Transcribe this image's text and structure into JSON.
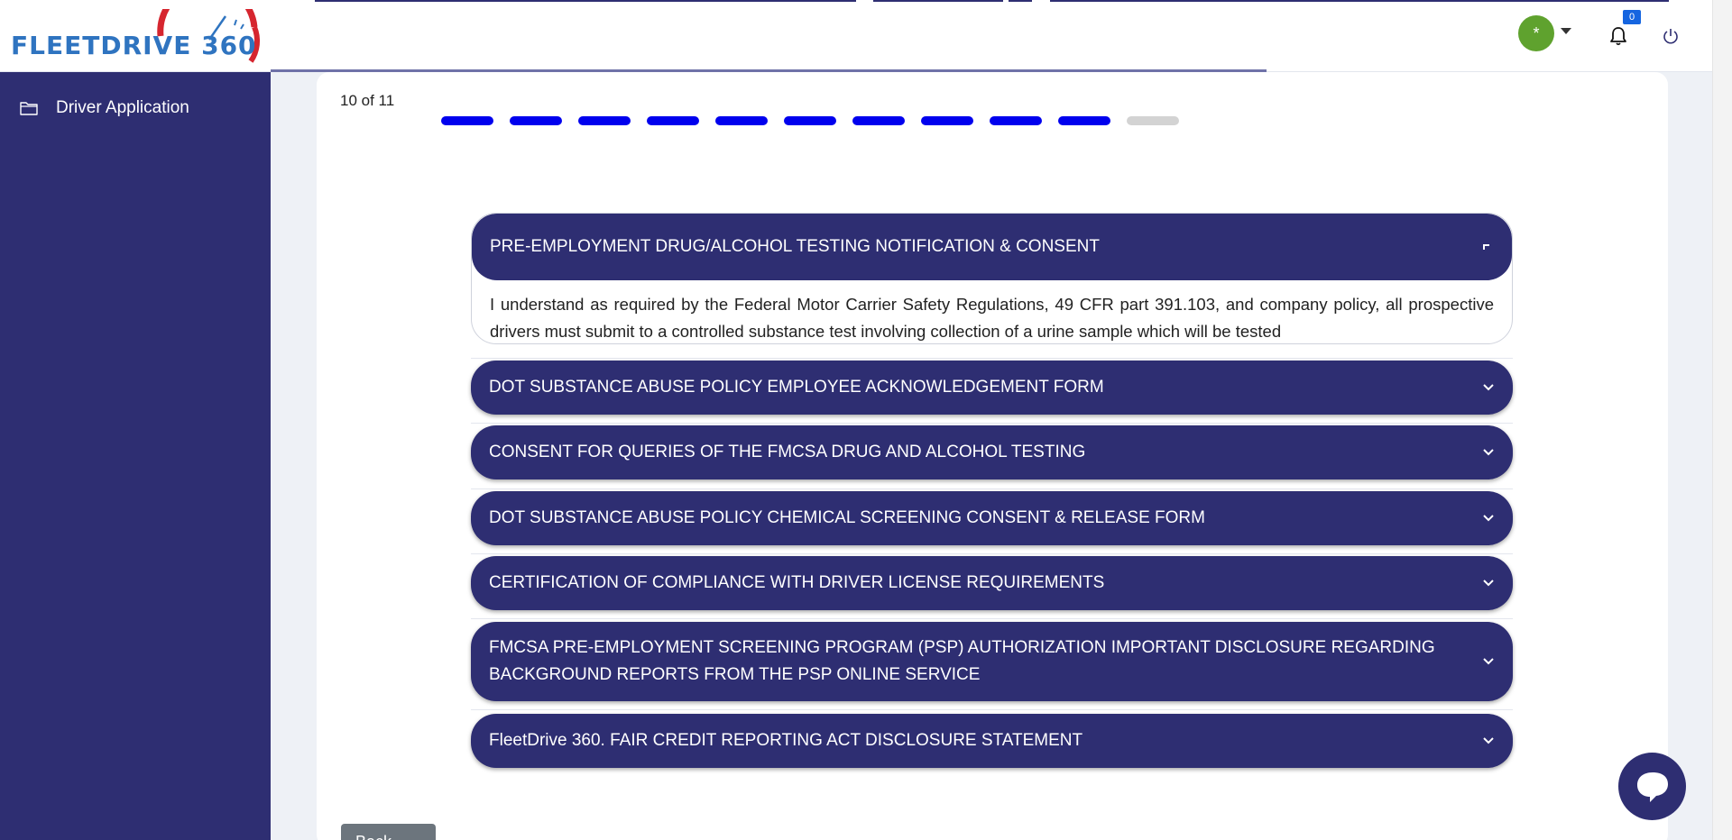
{
  "brand": {
    "logo_text": "FLEETDRIVE 360"
  },
  "header": {
    "avatar_symbol": "*",
    "notification_count": "0"
  },
  "sidebar": {
    "items": [
      {
        "label": "Driver Application",
        "icon": "folder-icon"
      }
    ]
  },
  "wizard": {
    "step_text": "10 of 11",
    "current_step": 10,
    "total_steps": 11
  },
  "sections": [
    {
      "title": "PRE-EMPLOYMENT DRUG/ALCOHOL TESTING NOTIFICATION & CONSENT",
      "expanded": true,
      "body": "I understand as required by the Federal Motor Carrier Safety Regulations, 49 CFR part 391.103, and company policy, all prospective drivers must submit to a controlled substance test involving collection of a urine sample which will be tested"
    },
    {
      "title": "DOT SUBSTANCE ABUSE POLICY EMPLOYEE ACKNOWLEDGEMENT FORM",
      "expanded": false
    },
    {
      "title": "CONSENT FOR QUERIES OF THE FMCSA DRUG AND ALCOHOL TESTING",
      "expanded": false
    },
    {
      "title": "DOT SUBSTANCE ABUSE POLICY CHEMICAL SCREENING CONSENT & RELEASE FORM",
      "expanded": false
    },
    {
      "title": "CERTIFICATION OF COMPLIANCE WITH DRIVER LICENSE REQUIREMENTS",
      "expanded": false
    },
    {
      "title": "FMCSA PRE-EMPLOYMENT SCREENING PROGRAM (PSP) AUTHORIZATION IMPORTANT DISCLOSURE REGARDING BACKGROUND REPORTS FROM THE PSP ONLINE SERVICE",
      "expanded": false
    },
    {
      "title": "FleetDrive 360. FAIR CREDIT REPORTING ACT DISCLOSURE STATEMENT",
      "expanded": false
    }
  ],
  "footer": {
    "back_label": "Back"
  },
  "colors": {
    "primary": "#2e2e72",
    "step_active": "#0000ee",
    "step_inactive": "#d3d3d3",
    "avatar": "#5fa22e",
    "badge": "#1565e0",
    "logo_blue": "#2f74c0",
    "logo_red": "#d6262f"
  }
}
